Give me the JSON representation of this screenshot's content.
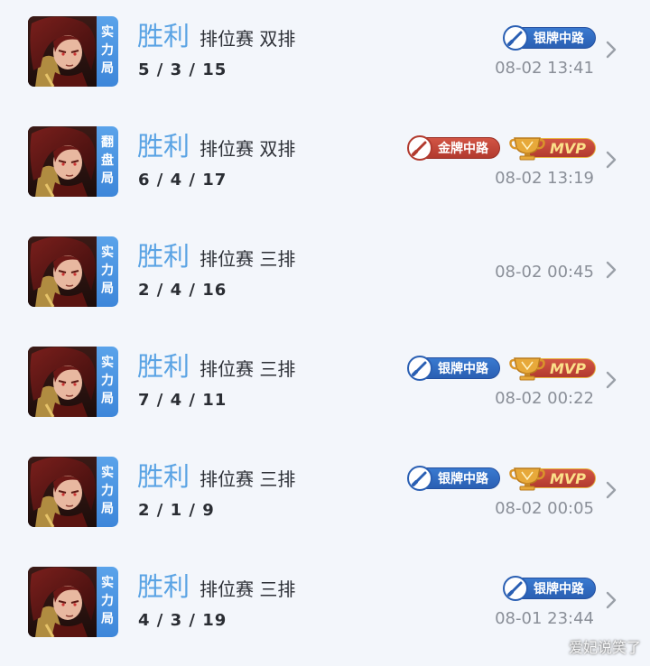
{
  "colors": {
    "background": "#f3f6fb",
    "result_win": "#5aa3e4",
    "mode_tag": "#4a94e0",
    "silver_badge": "#2a5fb3",
    "gold_badge": "#b23a2e",
    "mvp_text": "#fbe08a",
    "time_text": "#8a8f98"
  },
  "matches": [
    {
      "hero_icon": "hero-portrait",
      "mode_tag": "实\n力\n局",
      "result": "胜利",
      "match_type": "排位赛 双排",
      "kda": "5 / 3 / 15",
      "badges": [
        {
          "kind": "silver",
          "icon": "mid-lane-icon",
          "label": "银牌中路"
        }
      ],
      "mvp": null,
      "time": "08-02 13:41"
    },
    {
      "hero_icon": "hero-portrait",
      "mode_tag": "翻\n盘\n局",
      "result": "胜利",
      "match_type": "排位赛 双排",
      "kda": "6 / 4 / 17",
      "badges": [
        {
          "kind": "gold",
          "icon": "mid-lane-icon",
          "label": "金牌中路"
        }
      ],
      "mvp": "MVP",
      "time": "08-02 13:19"
    },
    {
      "hero_icon": "hero-portrait",
      "mode_tag": "实\n力\n局",
      "result": "胜利",
      "match_type": "排位赛 三排",
      "kda": "2 / 4 / 16",
      "badges": [],
      "mvp": null,
      "time": "08-02 00:45"
    },
    {
      "hero_icon": "hero-portrait",
      "mode_tag": "实\n力\n局",
      "result": "胜利",
      "match_type": "排位赛 三排",
      "kda": "7 / 4 / 11",
      "badges": [
        {
          "kind": "silver",
          "icon": "mid-lane-icon",
          "label": "银牌中路"
        }
      ],
      "mvp": "MVP",
      "time": "08-02 00:22"
    },
    {
      "hero_icon": "hero-portrait",
      "mode_tag": "实\n力\n局",
      "result": "胜利",
      "match_type": "排位赛 三排",
      "kda": "2 / 1 / 9",
      "badges": [
        {
          "kind": "silver",
          "icon": "mid-lane-icon",
          "label": "银牌中路"
        }
      ],
      "mvp": "MVP",
      "time": "08-02 00:05"
    },
    {
      "hero_icon": "hero-portrait",
      "mode_tag": "实\n力\n局",
      "result": "胜利",
      "match_type": "排位赛 三排",
      "kda": "4 / 3 / 19",
      "badges": [
        {
          "kind": "silver",
          "icon": "mid-lane-icon",
          "label": "银牌中路"
        }
      ],
      "mvp": null,
      "time": "08-01 23:44"
    }
  ],
  "watermark": "爱妃说笑了"
}
